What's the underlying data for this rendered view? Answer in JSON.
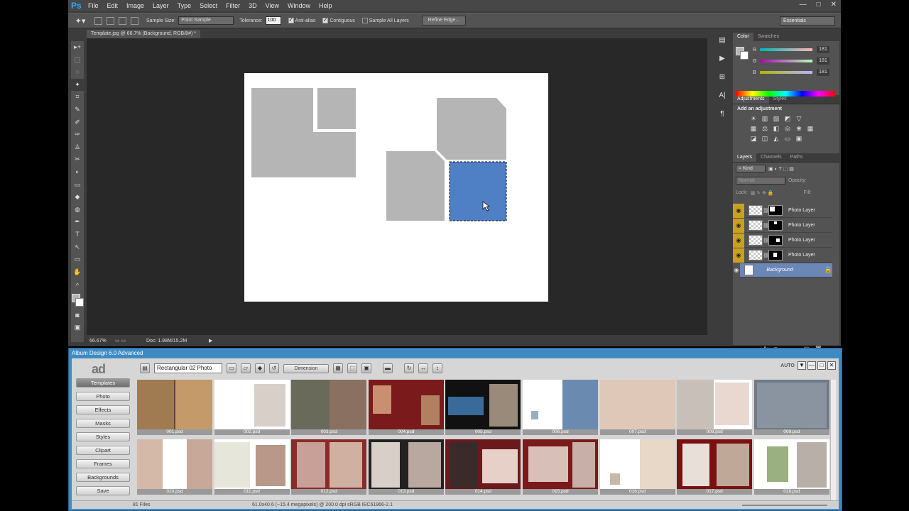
{
  "ps": {
    "logo": "Ps",
    "menu": [
      "File",
      "Edit",
      "Image",
      "Layer",
      "Type",
      "Select",
      "Filter",
      "3D",
      "View",
      "Window",
      "Help"
    ],
    "window_controls": [
      "—",
      "□",
      "✕"
    ],
    "options": {
      "sample_size_label": "Sample Size:",
      "sample_size_value": "Point Sample",
      "tolerance_label": "Tolerance:",
      "tolerance_value": "100",
      "anti_alias": "Anti-alias",
      "contiguous": "Contiguous",
      "sample_all_layers": "Sample All Layers",
      "refine_edge": "Refine Edge...",
      "workspace": "Essentials"
    },
    "doc_tab": "Template.jpg @ 66.7% (Background, RGB/8#) *",
    "status": {
      "zoom": "66.67%",
      "doc": "Doc: 1.98M/15.2M"
    },
    "tools": [
      "▸+",
      "⬚",
      "◌",
      "✦",
      "⌗",
      "✎",
      "✐",
      "✑",
      "♙",
      "✂",
      "◐",
      "▭",
      "◆",
      "◍",
      "✒",
      "T",
      "↖",
      "▭",
      "✋",
      "⌕"
    ],
    "color_panel": {
      "tabs": [
        "Color",
        "Swatches"
      ],
      "r_label": "R",
      "r_value": "181",
      "g_label": "G",
      "g_value": "181",
      "b_label": "B",
      "b_value": "181"
    },
    "adjustments": {
      "tabs": [
        "Adjustments",
        "Styles"
      ],
      "title": "Add an adjustment"
    },
    "layers": {
      "tabs": [
        "Layers",
        "Channels",
        "Paths"
      ],
      "kind": "Kind",
      "blend": "Normal",
      "opacity_label": "Opacity:",
      "lock_label": "Lock:",
      "fill_label": "Fill:",
      "items": [
        {
          "name": "Photo Layer"
        },
        {
          "name": "Photo Layer"
        },
        {
          "name": "Photo Layer"
        },
        {
          "name": "Photo Layer"
        },
        {
          "name": "Background"
        }
      ]
    }
  },
  "album": {
    "title": "Album Design 6.0 Advanced",
    "logo": "ad",
    "sidebar": [
      "Templates",
      "Photo",
      "Effects",
      "Masks",
      "Styles",
      "Clipart",
      "Frames",
      "Backgrounds",
      "Save"
    ],
    "toolbar": {
      "layout_select": "Rectangular 02 Photo",
      "dimension_button": "Dimension",
      "auto_label": "AUTO"
    },
    "window_controls": [
      "▼",
      "—",
      "□",
      "✕"
    ],
    "templates": [
      {
        "name": "001.psd",
        "bg": "#5a4a3a"
      },
      {
        "name": "002.psd",
        "bg": "#ffffff"
      },
      {
        "name": "003.psd",
        "bg": "#3a3a3a"
      },
      {
        "name": "004.psd",
        "bg": "#7a1a1a"
      },
      {
        "name": "005.psd",
        "bg": "#111111"
      },
      {
        "name": "006.psd",
        "bg": "#ffffff"
      },
      {
        "name": "007.psd",
        "bg": "#f2ece6"
      },
      {
        "name": "008.psd",
        "bg": "#ffffff"
      },
      {
        "name": "009.psd",
        "bg": "#707a86"
      },
      {
        "name": "010.psd",
        "bg": "#ffffff"
      },
      {
        "name": "011.psd",
        "bg": "#ffffff"
      },
      {
        "name": "012.psd",
        "bg": "#8a2a2a"
      },
      {
        "name": "013.psd",
        "bg": "#222222"
      },
      {
        "name": "014.psd",
        "bg": "#6a1a1a"
      },
      {
        "name": "015.psd",
        "bg": "#7a1a1a"
      },
      {
        "name": "016.psd",
        "bg": "#ffffff"
      },
      {
        "name": "017.psd",
        "bg": "#7a1010"
      },
      {
        "name": "018.psd",
        "bg": "#ffffff"
      }
    ],
    "status": {
      "files": "81 Files",
      "info": "61.0x40.6 (~15.4 megapixels) @ 200.0 dpi   sRGB IEC61966-2.1"
    }
  },
  "colors": {
    "selection_blue": "#4f7fc4",
    "placeholder_gray": "#b5b5b5",
    "layer_eye_gold": "#c8a21e",
    "album_frame_blue": "#3e8bc4"
  }
}
